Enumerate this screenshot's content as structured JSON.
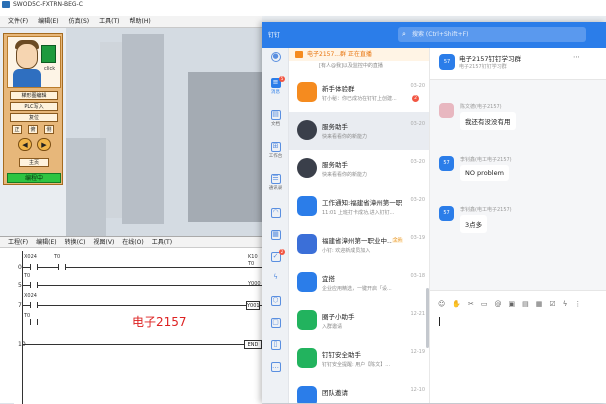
{
  "sim": {
    "title": "SWOD5C-FXTRN-BEG-C",
    "menu": [
      "文件(F)",
      "编辑(E)",
      "仿真(S)",
      "工具(T)",
      "帮助(H)"
    ],
    "click_label": "click",
    "buttons": [
      "梯形图编辑",
      "PLC写入",
      "复位"
    ],
    "mini_buttons": [
      "正",
      "俯",
      "侧"
    ],
    "home": "主页",
    "status": "编程中",
    "ladder_menu": [
      "工程(F)",
      "编辑(E)",
      "转换(C)",
      "视图(V)",
      "在线(O)",
      "工具(T)"
    ],
    "rungs": [
      {
        "num": "0",
        "contact": "X024",
        "contact2": "T0",
        "coil": "K10",
        "coil2": "T0"
      },
      {
        "num": "5",
        "contact": "T0",
        "coil": "Y000"
      },
      {
        "num": "7",
        "contact": "X024",
        "contact2": "T0",
        "coil": "Y001"
      },
      {
        "num": "10",
        "coil": "END"
      }
    ],
    "watermark": "电子2157"
  },
  "dingtalk": {
    "logo": "钉钉",
    "search_placeholder": "搜索 (Ctrl+Shift+F)",
    "nav": [
      {
        "label": "",
        "icon": "person-icon"
      },
      {
        "label": "消息",
        "icon": "message-icon",
        "badge": "5",
        "active": true
      },
      {
        "label": "文档",
        "icon": "doc-icon"
      },
      {
        "label": "工作台",
        "icon": "grid-icon"
      },
      {
        "label": "通讯录",
        "icon": "contacts-icon"
      },
      {
        "label": "",
        "icon": "cloud-icon"
      },
      {
        "label": "",
        "icon": "calendar-icon"
      },
      {
        "label": "",
        "icon": "todo-icon",
        "badge": "2"
      },
      {
        "label": "",
        "icon": "lightning-icon"
      },
      {
        "label": "",
        "icon": "hexagon-icon"
      },
      {
        "label": "",
        "icon": "bag-icon"
      },
      {
        "label": "",
        "icon": "file-icon"
      },
      {
        "label": "",
        "icon": "more-icon"
      }
    ],
    "live_bar": "电子2157...群 正在直播",
    "sub_bar": "[有人@我]以及监控中的直播",
    "conversations": [
      {
        "name": "新手体验群",
        "msg": "钉小秘：你已成功在钉钉上创建...",
        "time": "03-20",
        "badge": "2",
        "color": "#f58b1f"
      },
      {
        "name": "服务助手",
        "msg": "快来看看你的新能力",
        "time": "03-20",
        "color": "#3a3f4a",
        "active": true
      },
      {
        "name": "服务助手",
        "msg": "快来看看你的新能力",
        "time": "03-20",
        "color": "#3a3f4a"
      },
      {
        "name": "工作通知:福建省漳州第一职...",
        "msg": "11:01 上班打卡成功,进入钉钉...",
        "time": "03-20",
        "color": "#2b7de9"
      },
      {
        "name": "福建省漳州第一职业中...",
        "tag": "全员",
        "msg": "小钉: 欢迎新成员加入",
        "time": "03-19",
        "color": "#3b6fd8"
      },
      {
        "name": "宜搭",
        "msg": "企业应用精选，一键开启「设...",
        "time": "03-18",
        "color": "#2b7de9"
      },
      {
        "name": "圈子小助手",
        "msg": "入群邀请",
        "time": "12-21",
        "color": "#22b35e"
      },
      {
        "name": "钉钉安全助手",
        "msg": "钉钉安全提醒: 用户【陈文】...",
        "time": "12-19",
        "color": "#22b35e"
      },
      {
        "name": "团队邀请",
        "msg": "",
        "time": "12-10",
        "color": "#2b7de9"
      }
    ],
    "chat": {
      "avatar_label": "57",
      "title": "电子2157钉钉学习群",
      "subtitle": "电子2157钉钉学习群",
      "messages": [
        {
          "sender": "陈文德(电子2157)",
          "text": "我还有没没有用",
          "avatar": "photo"
        },
        {
          "sender": "李钊鑫(电工电子2157)",
          "text": "NO problem",
          "avatar": "57"
        },
        {
          "sender": "李钊鑫(电工电子2157)",
          "text": "3点多",
          "avatar": "57"
        }
      ]
    }
  }
}
